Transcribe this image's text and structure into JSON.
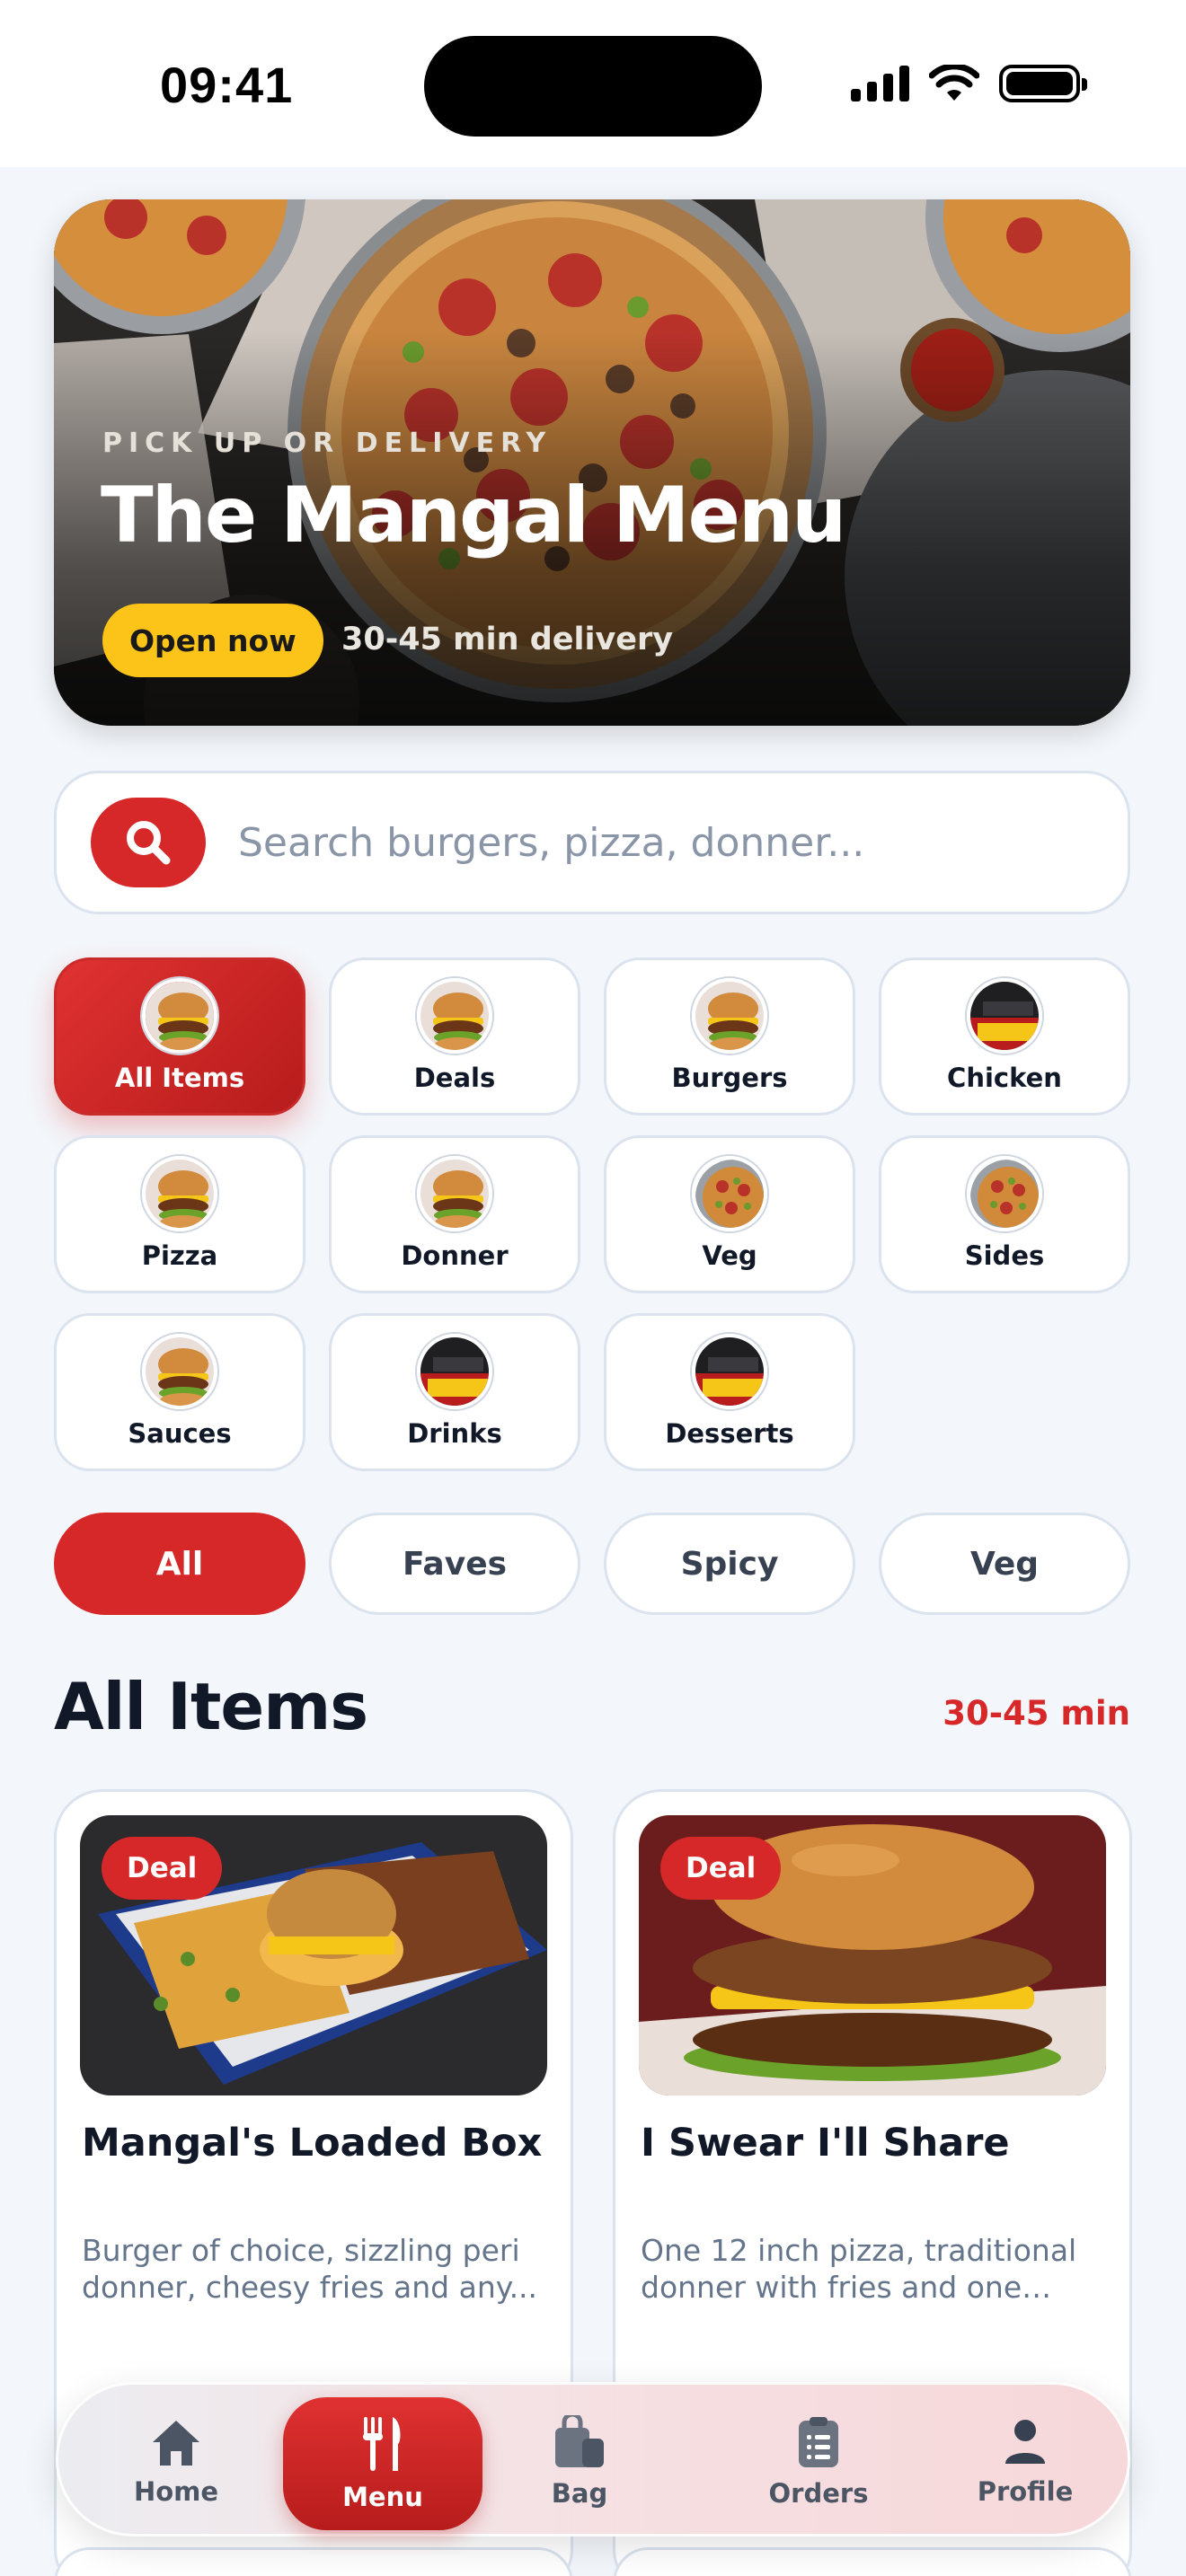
{
  "status": {
    "time": "09:41"
  },
  "hero": {
    "eyebrow": "PICK UP OR DELIVERY",
    "title": "The Mangal Menu",
    "status_pill": "Open now",
    "eta": "30-45 min delivery",
    "accent": "#fcc419"
  },
  "search": {
    "placeholder": "Search burgers, pizza, donner..."
  },
  "categories": [
    {
      "label": "All Items",
      "active": true,
      "thumb": "burger"
    },
    {
      "label": "Deals",
      "thumb": "burger"
    },
    {
      "label": "Burgers",
      "thumb": "burger"
    },
    {
      "label": "Chicken",
      "thumb": "store"
    },
    {
      "label": "Pizza",
      "thumb": "burger"
    },
    {
      "label": "Donner",
      "thumb": "burger"
    },
    {
      "label": "Veg",
      "thumb": "pizza"
    },
    {
      "label": "Sides",
      "thumb": "pizza"
    },
    {
      "label": "Sauces",
      "thumb": "burger"
    },
    {
      "label": "Drinks",
      "thumb": "store"
    },
    {
      "label": "Desserts",
      "thumb": "store"
    }
  ],
  "filters": [
    {
      "label": "All",
      "active": true
    },
    {
      "label": "Faves"
    },
    {
      "label": "Spicy"
    },
    {
      "label": "Veg"
    }
  ],
  "section": {
    "title": "All Items",
    "meta": "30-45 min"
  },
  "products": [
    {
      "badge": "Deal",
      "title": "Mangal's Loaded Box",
      "description": "Burger of choice, sizzling peri donner, cheesy fries and any..."
    },
    {
      "badge": "Deal",
      "title": "I Swear I'll Share",
      "description": "One 12 inch pizza, traditional donner with fries and one sau..."
    }
  ],
  "tabs": [
    {
      "label": "Home",
      "icon": "home-icon"
    },
    {
      "label": "Menu",
      "icon": "fork-knife-icon",
      "active": true
    },
    {
      "label": "Bag",
      "icon": "bag-icon"
    },
    {
      "label": "Orders",
      "icon": "clipboard-icon"
    },
    {
      "label": "Profile",
      "icon": "person-icon"
    }
  ],
  "colors": {
    "brand": "#d62828",
    "background": "#f3f6fa",
    "text": "#111827"
  }
}
